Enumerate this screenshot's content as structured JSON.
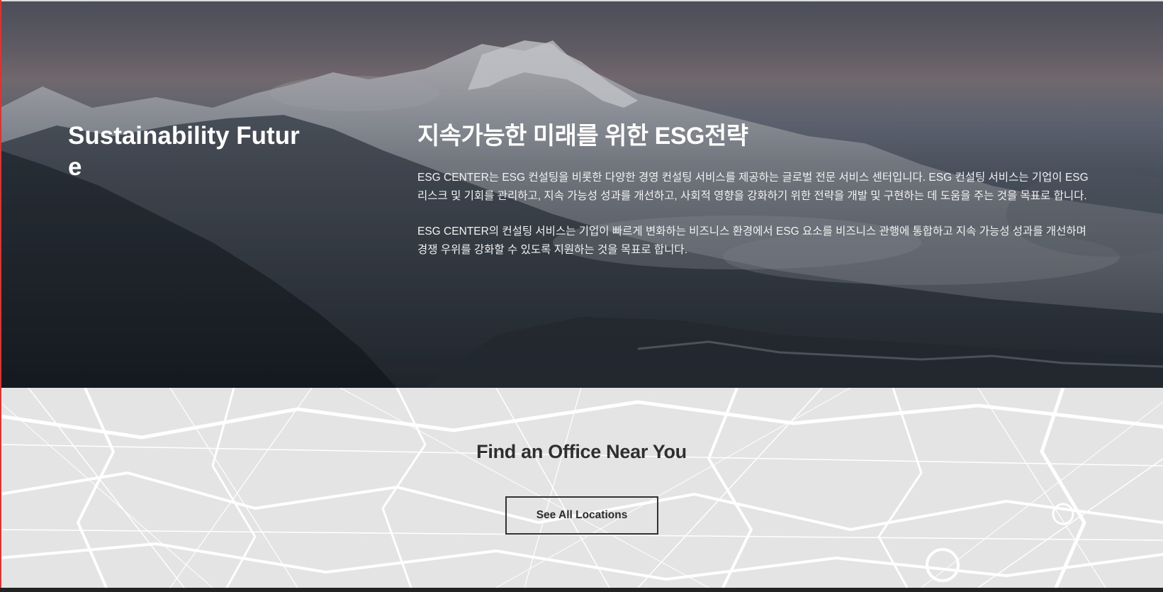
{
  "hero": {
    "heading": "Sustainability Future",
    "title": "지속가능한 미래를 위한 ESG전략",
    "paragraph_1": "ESG CENTER는 ESG 컨설팅을 비롯한 다양한 경영 컨설팅 서비스를 제공하는 글로벌 전문 서비스 센터입니다. ESG 컨설팅 서비스는 기업이 ESG 리스크 및 기회를 관리하고, 지속 가능성 성과를 개선하고, 사회적 영향을 강화하기 위한 전략을 개발 및 구현하는 데 도움을 주는 것을 목표로 합니다.",
    "paragraph_2": "ESG CENTER의 컨설팅 서비스는 기업이 빠르게 변화하는 비즈니스 환경에서 ESG 요소를 비즈니스 관행에 통합하고 지속 가능성 성과를 개선하며 경쟁 우위를 강화할 수 있도록 지원하는 것을 목표로 합니다."
  },
  "office": {
    "title": "Find an Office Near You",
    "button_label": "See All Locations"
  },
  "colors": {
    "accent_edge": "#e0332f",
    "map_background": "#e4e4e4",
    "button_border": "#333333",
    "footer_bar": "#232323"
  }
}
